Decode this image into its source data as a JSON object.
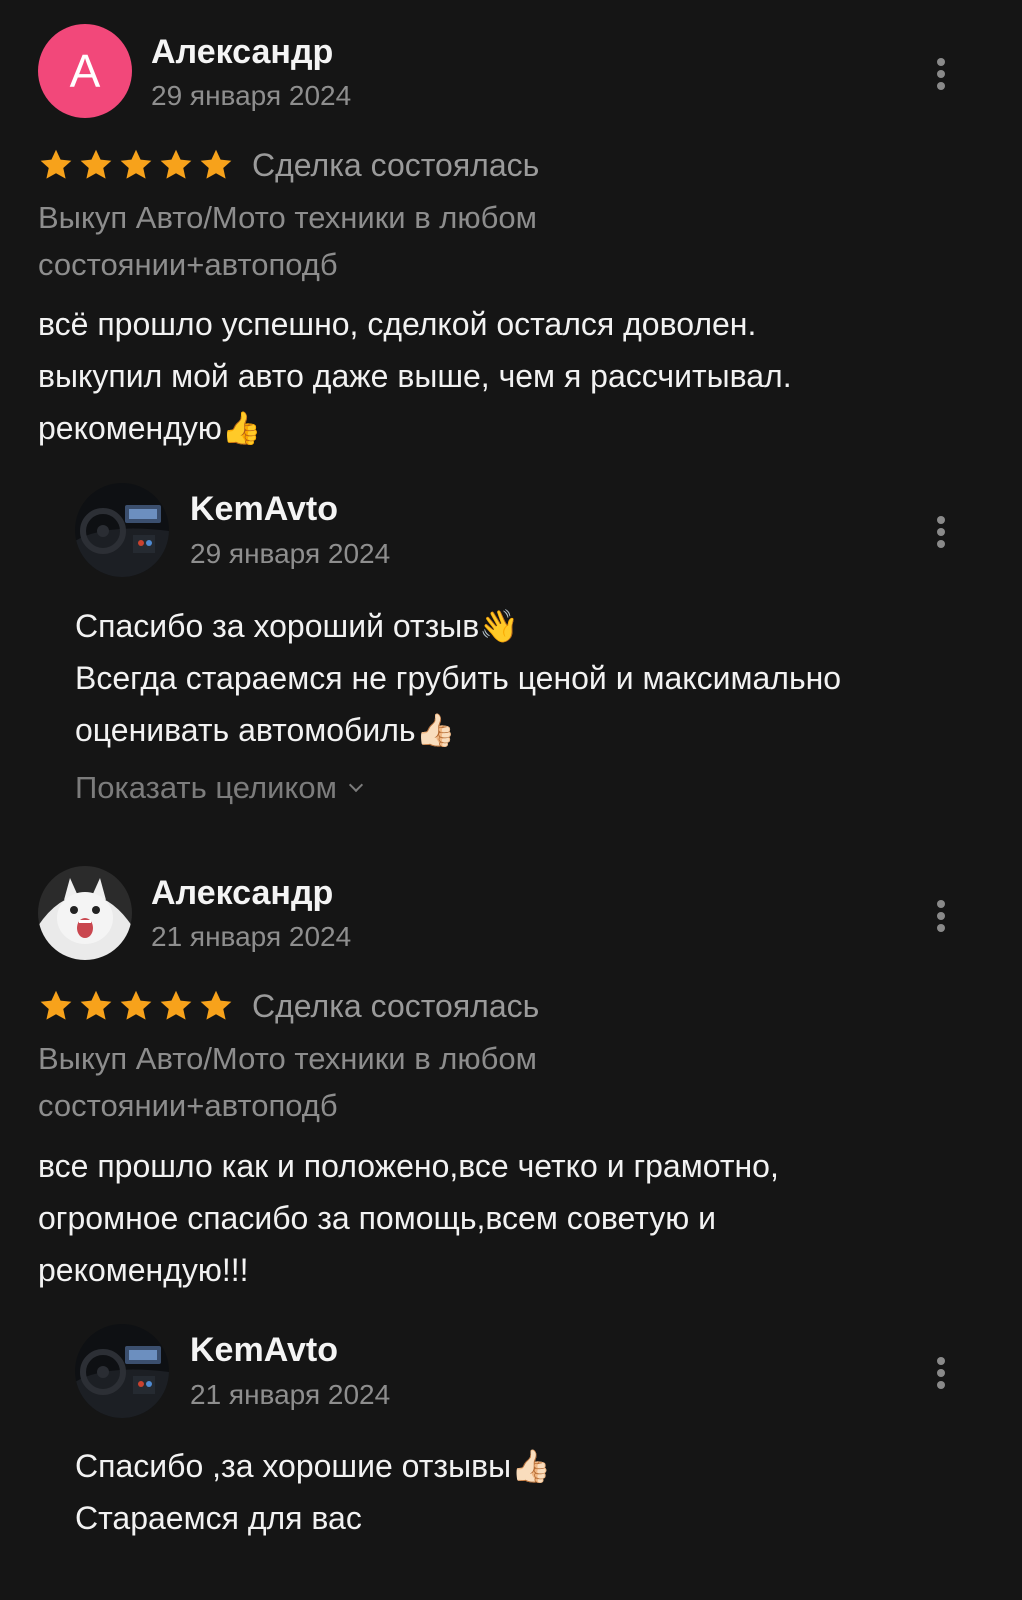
{
  "reviews": [
    {
      "author": "Александр",
      "avatar_letter": "А",
      "avatar_color": "#f2487a",
      "date": "29 января 2024",
      "rating": 5,
      "deal_status": "Сделка состоялась",
      "service_line1": "Выкуп Авто/Мото техники в любом",
      "service_line2": "состоянии+автоподб",
      "text_line1": "всё прошло успешно, сделкой остался доволен.",
      "text_line2": "выкупил мой авто даже выше, чем я рассчитывал.",
      "text_line3": "рекомендую",
      "text_line3_emoji": "👍",
      "reply": {
        "author": "KemAvto",
        "date": "29 января 2024",
        "line1": "Спасибо за хороший отзыв",
        "line1_emoji": "👋",
        "line2": "Всегда стараемся не грубить ценой и максимально",
        "line3": "оценивать автомобиль",
        "line3_emoji": "👍🏻",
        "show_more": "Показать целиком"
      }
    },
    {
      "author": "Александр",
      "avatar_icon": "cat-photo-avatar",
      "date": "21 января 2024",
      "rating": 5,
      "deal_status": "Сделка состоялась",
      "service_line1": "Выкуп Авто/Мото техники в любом",
      "service_line2": "состоянии+автоподб",
      "text_line1": "все прошло как и положено,все четко и грамотно,",
      "text_line2": "огромное спасибо за помощь,всем советую и",
      "text_line3": "рекомендую!!!",
      "reply": {
        "author": "KemAvto",
        "date": "21 января 2024",
        "line1": "Спасибо ,за хорошие отзывы",
        "line1_emoji": "👍🏻",
        "line2": "Стараемся для вас"
      }
    }
  ],
  "colors": {
    "background": "#151515",
    "star": "#f7a21b",
    "text_primary": "#f2f2f2",
    "text_secondary": "#8e8e8e"
  }
}
